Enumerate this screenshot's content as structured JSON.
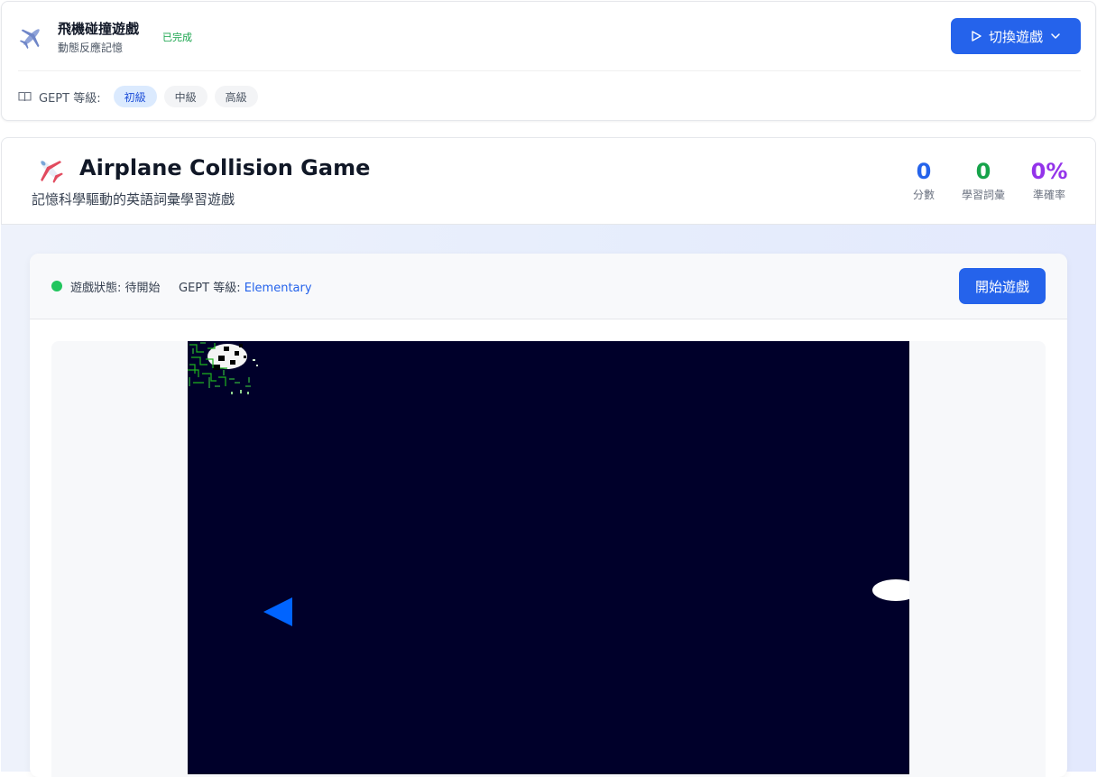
{
  "header": {
    "app_title": "飛機碰撞遊戲",
    "app_subtitle": "動態反應記憶",
    "completion_status": "已完成",
    "switch_button_label": "切換遊戲",
    "gept_label": "GEPT 等級:",
    "levels": [
      {
        "label": "初級",
        "selected": true
      },
      {
        "label": "中級",
        "selected": false
      },
      {
        "label": "高級",
        "selected": false
      }
    ]
  },
  "hero": {
    "title": "Airplane Collision Game",
    "subtitle": "記憶科學驅動的英語詞彙學習遊戲",
    "stats": [
      {
        "value": "0",
        "label": "分數",
        "color": "#2563eb"
      },
      {
        "value": "0",
        "label": "學習詞彙",
        "color": "#16a34a"
      },
      {
        "value": "0%",
        "label": "準確率",
        "color": "#9333ea"
      }
    ]
  },
  "game": {
    "status_text": "遊戲狀態: 待開始",
    "level_prefix": "GEPT 等級:",
    "level_value": "Elementary",
    "start_button_label": "開始遊戲",
    "canvas_background": "#00002a",
    "player_color": "#0064ff"
  },
  "icons": {
    "app": "airplane-icon",
    "switch": "play-icon",
    "switch_dropdown": "chevron-down-icon",
    "gept": "book-icon",
    "hero": "airplane-icon",
    "status": "status-dot-icon"
  },
  "colors": {
    "primary": "#2563eb",
    "success": "#16a34a",
    "accent_purple": "#9333ea",
    "status_dot": "#22c55e"
  }
}
